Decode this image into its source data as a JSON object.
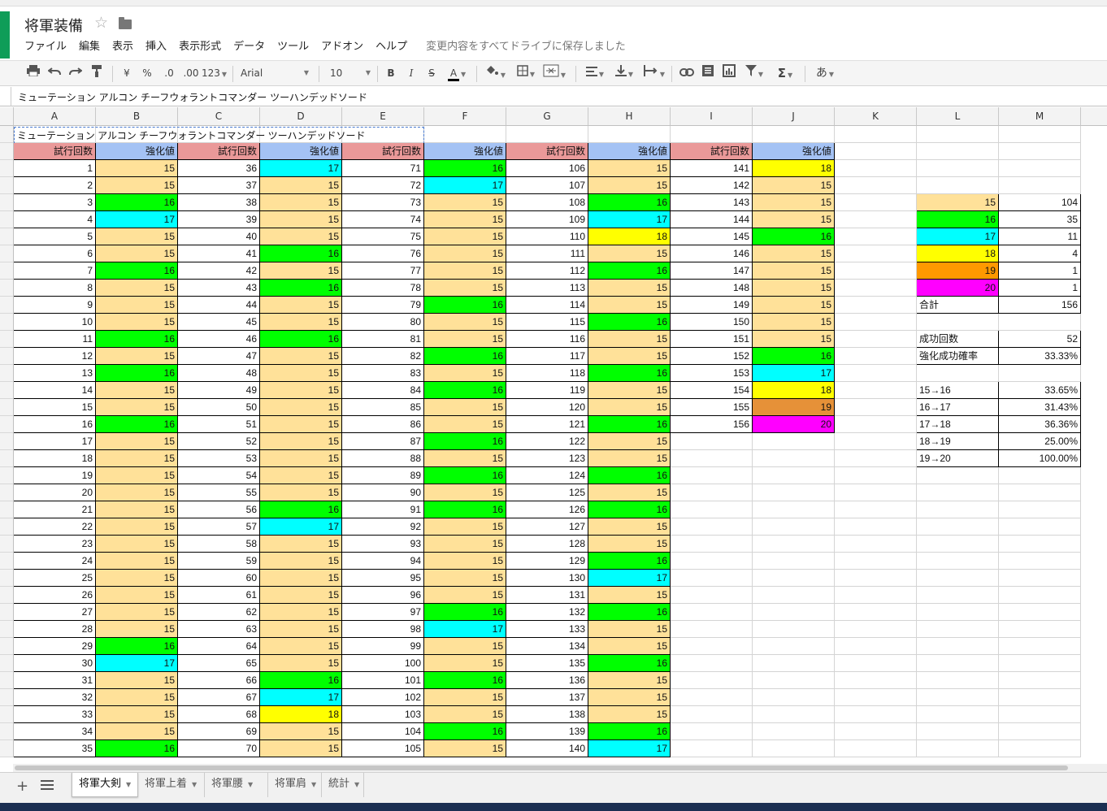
{
  "app": {
    "title": "将軍装備",
    "menu": [
      "ファイル",
      "編集",
      "表示",
      "挿入",
      "表示形式",
      "データ",
      "ツール",
      "アドオン",
      "ヘルプ"
    ],
    "save_status": "変更内容をすべてドライブに保存しました"
  },
  "toolbar": {
    "currency": "¥",
    "percent": "%",
    "dec_decrease": ".0",
    "dec_increase": ".00",
    "more_formats": "123",
    "font": "Arial",
    "font_size": "10",
    "bold": "B",
    "italic": "I",
    "strike": "S",
    "text_color": "A",
    "input_tool": "あ",
    "sigma": "Σ",
    "icons": [
      "print-icon",
      "undo-icon",
      "redo-icon",
      "paint-format-icon",
      "fill-color-icon",
      "borders-icon",
      "merge-cells-icon",
      "align-icon",
      "valign-icon",
      "text-wrap-icon",
      "link-icon",
      "comment-icon",
      "chart-icon",
      "filter-icon",
      "functions-icon"
    ]
  },
  "formula_bar": {
    "value": "ミューテーション アルコン チーフウォラントコマンダー ツーハンデッドソード"
  },
  "columns": [
    "A",
    "B",
    "C",
    "D",
    "E",
    "F",
    "G",
    "H",
    "I",
    "J",
    "K",
    "L",
    "M"
  ],
  "sheet": {
    "title": "ミューテーション アルコン チーフウォラントコマンダー ツーハンデッドソード",
    "header_trial": "試行回数",
    "header_value": "強化値",
    "values": [
      [
        15,
        15,
        16,
        17,
        15,
        15,
        16,
        15,
        15,
        15,
        16,
        15,
        16,
        15,
        15,
        16,
        15,
        15,
        15,
        15,
        15,
        15,
        15,
        15,
        15,
        15,
        15,
        15,
        16,
        17,
        15,
        15,
        15,
        15,
        16
      ],
      [
        17,
        15,
        15,
        15,
        15,
        16,
        15,
        16,
        15,
        15,
        16,
        15,
        15,
        15,
        15,
        15,
        15,
        15,
        15,
        15,
        16,
        17,
        15,
        15,
        15,
        15,
        15,
        15,
        15,
        15,
        16,
        17,
        18,
        15,
        15
      ],
      [
        16,
        17,
        15,
        15,
        15,
        15,
        15,
        15,
        16,
        15,
        15,
        16,
        15,
        16,
        15,
        15,
        16,
        15,
        16,
        15,
        16,
        15,
        15,
        15,
        15,
        15,
        16,
        17,
        15,
        15,
        16,
        15,
        15,
        16,
        15
      ],
      [
        15,
        15,
        16,
        17,
        18,
        15,
        16,
        15,
        15,
        16,
        15,
        15,
        16,
        15,
        15,
        16,
        15,
        15,
        16,
        15,
        16,
        15,
        15,
        16,
        17,
        15,
        16,
        15,
        15,
        16,
        15,
        15,
        15,
        16,
        17
      ],
      [
        18,
        15,
        15,
        15,
        16,
        15,
        15,
        15,
        15,
        15,
        15,
        16,
        17,
        18,
        19,
        20
      ]
    ],
    "colors": {
      "15": "#ffe199",
      "16": "#00ff00",
      "17": "#00ffff",
      "18": "#ffff00",
      "19": "#e69138",
      "20": "#ff00ff"
    },
    "header_colors": {
      "trial": "#ea9999",
      "value": "#a4c2f4"
    }
  },
  "stats": {
    "counts": [
      {
        "value": "15",
        "count": "104",
        "color": "#ffe199"
      },
      {
        "value": "16",
        "count": "35",
        "color": "#00ff00"
      },
      {
        "value": "17",
        "count": "11",
        "color": "#00ffff"
      },
      {
        "value": "18",
        "count": "4",
        "color": "#ffff00"
      },
      {
        "value": "19",
        "count": "1",
        "color": "#ff9900"
      },
      {
        "value": "20",
        "count": "1",
        "color": "#ff00ff"
      }
    ],
    "total_label": "合計",
    "total_value": "156",
    "success_label": "成功回数",
    "success_value": "52",
    "rate_label": "強化成功確率",
    "rate_value": "33.33%",
    "transitions": [
      {
        "label": "15→16",
        "value": "33.65%"
      },
      {
        "label": "16→17",
        "value": "31.43%"
      },
      {
        "label": "17→18",
        "value": "36.36%"
      },
      {
        "label": "18→19",
        "value": "25.00%"
      },
      {
        "label": "19→20",
        "value": "100.00%"
      }
    ]
  },
  "tabs": [
    "将軍大剣",
    "将軍上着",
    "将軍腰",
    "将軍肩",
    "統計"
  ],
  "active_tab": 0
}
